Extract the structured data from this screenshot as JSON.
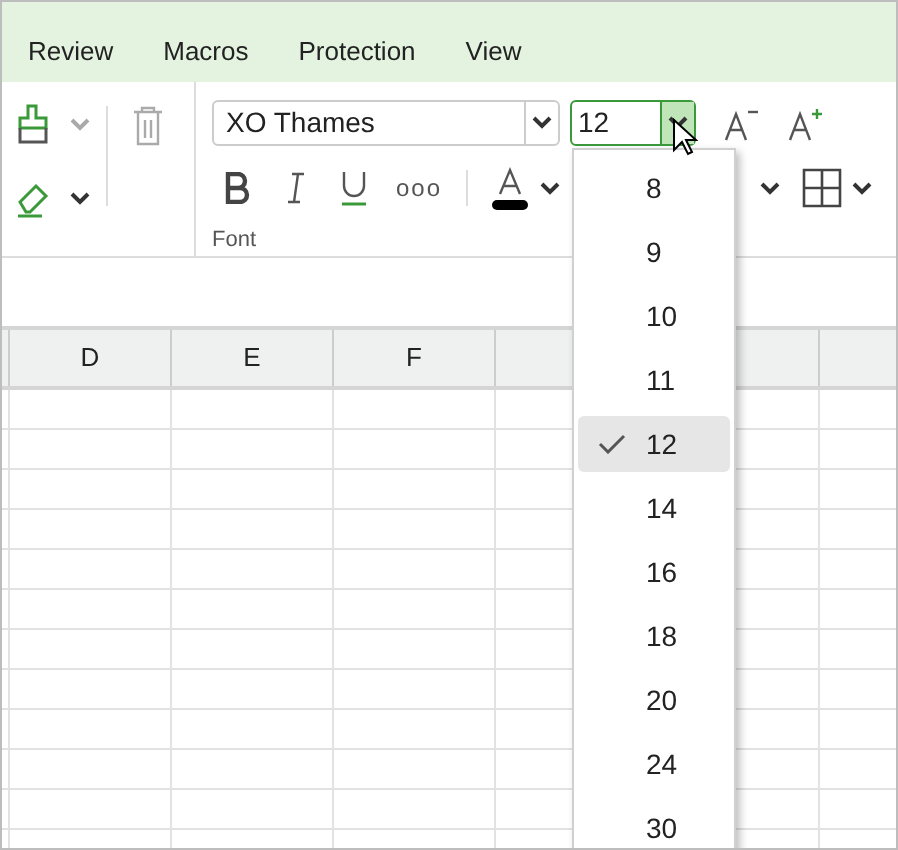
{
  "menu_tabs": [
    {
      "label": "Review"
    },
    {
      "label": "Macros"
    },
    {
      "label": "Protection"
    },
    {
      "label": "View"
    }
  ],
  "toolbar": {
    "font_family": {
      "value": "XO Thames"
    },
    "font_size": {
      "value": "12"
    },
    "group_label": "Font",
    "more_label": "ooo"
  },
  "columns": [
    "D",
    "E",
    "F"
  ],
  "font_size_menu": [
    {
      "label": "8",
      "selected": false
    },
    {
      "label": "9",
      "selected": false
    },
    {
      "label": "10",
      "selected": false
    },
    {
      "label": "11",
      "selected": false
    },
    {
      "label": "12",
      "selected": true
    },
    {
      "label": "14",
      "selected": false
    },
    {
      "label": "16",
      "selected": false
    },
    {
      "label": "18",
      "selected": false
    },
    {
      "label": "20",
      "selected": false
    },
    {
      "label": "24",
      "selected": false
    },
    {
      "label": "30",
      "selected": false
    }
  ]
}
